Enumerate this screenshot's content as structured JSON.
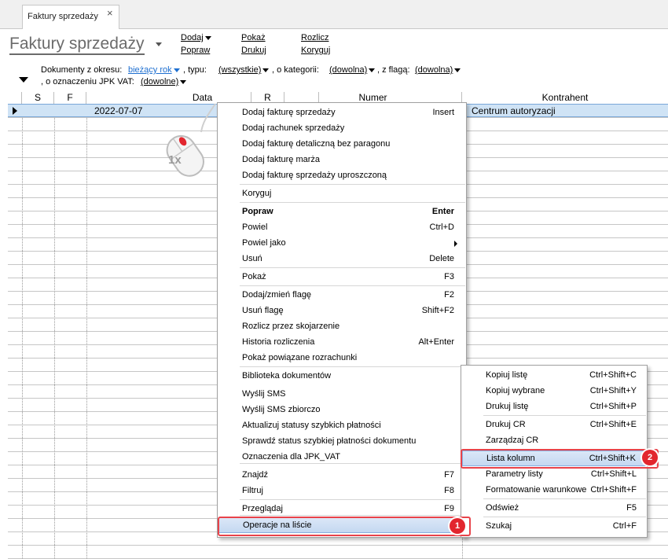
{
  "tab": {
    "label": "Faktury sprzedaży",
    "close": "×"
  },
  "page": {
    "title": "Faktury sprzedaży"
  },
  "actions": {
    "dodaj": "Dodaj",
    "popraw": "Popraw",
    "pokaz": "Pokaż",
    "drukuj": "Drukuj",
    "rozlicz": "Rozlicz",
    "koryguj": "Koryguj"
  },
  "filters": {
    "okres_label": "Dokumenty z okresu:",
    "okres_value": "bieżący rok",
    "typ_label": ", typu:",
    "typ_value": "(wszystkie)",
    "kategoria_label": ", o kategorii:",
    "kategoria_value": "(dowolna)",
    "flaga_label": ", z flagą:",
    "flaga_value": "(dowolna)",
    "jpk_label": ", o oznaczeniu JPK VAT:",
    "jpk_value": "(dowolne)"
  },
  "columns": [
    "S",
    "F",
    "Data",
    "R",
    "Numer",
    "Kontrahent"
  ],
  "selected_row": {
    "data": "2022-07-07",
    "kontrahent": "Centrum autoryzacji"
  },
  "mouse_hint": "1x",
  "context_menu": {
    "items": [
      {
        "label": "Dodaj fakturę sprzedaży",
        "shortcut": "Insert"
      },
      {
        "label": "Dodaj rachunek sprzedaży",
        "shortcut": ""
      },
      {
        "label": "Dodaj fakturę detaliczną bez paragonu",
        "shortcut": ""
      },
      {
        "label": "Dodaj fakturę marża",
        "shortcut": ""
      },
      {
        "label": "Dodaj fakturę sprzedaży uproszczoną",
        "shortcut": ""
      },
      {
        "label": "Koryguj",
        "shortcut": ""
      },
      {
        "label": "Popraw",
        "shortcut": "Enter"
      },
      {
        "label": "Powiel",
        "shortcut": "Ctrl+D"
      },
      {
        "label": "Powiel jako",
        "shortcut": ""
      },
      {
        "label": "Usuń",
        "shortcut": "Delete"
      },
      {
        "label": "Pokaż",
        "shortcut": "F3"
      },
      {
        "label": "Dodaj/zmień flagę",
        "shortcut": "F2"
      },
      {
        "label": "Usuń flagę",
        "shortcut": "Shift+F2"
      },
      {
        "label": "Rozlicz przez skojarzenie",
        "shortcut": ""
      },
      {
        "label": "Historia rozliczenia",
        "shortcut": "Alt+Enter"
      },
      {
        "label": "Pokaż powiązane rozrachunki",
        "shortcut": ""
      },
      {
        "label": "Biblioteka dokumentów",
        "shortcut": ""
      },
      {
        "label": "Wyślij SMS",
        "shortcut": ""
      },
      {
        "label": "Wyślij SMS zbiorczo",
        "shortcut": ""
      },
      {
        "label": "Aktualizuj statusy szybkich płatności",
        "shortcut": ""
      },
      {
        "label": "Sprawdź status szybkiej płatności dokumentu",
        "shortcut": ""
      },
      {
        "label": "Oznaczenia dla JPK_VAT",
        "shortcut": ""
      },
      {
        "label": "Znajdź",
        "shortcut": "F7"
      },
      {
        "label": "Filtruj",
        "shortcut": "F8"
      },
      {
        "label": "Przeglądaj",
        "shortcut": "F9"
      },
      {
        "label": "Operacje na liście",
        "shortcut": ""
      }
    ]
  },
  "submenu": {
    "items": [
      {
        "label": "Kopiuj listę",
        "shortcut": "Ctrl+Shift+C"
      },
      {
        "label": "Kopiuj wybrane",
        "shortcut": "Ctrl+Shift+Y"
      },
      {
        "label": "Drukuj listę",
        "shortcut": "Ctrl+Shift+P"
      },
      {
        "label": "Drukuj CR",
        "shortcut": "Ctrl+Shift+E"
      },
      {
        "label": "Zarządzaj CR",
        "shortcut": ""
      },
      {
        "label": "Lista kolumn",
        "shortcut": "Ctrl+Shift+K"
      },
      {
        "label": "Parametry listy",
        "shortcut": "Ctrl+Shift+L"
      },
      {
        "label": "Formatowanie warunkowe",
        "shortcut": "Ctrl+Shift+F"
      },
      {
        "label": "Odśwież",
        "shortcut": "F5"
      },
      {
        "label": "Szukaj",
        "shortcut": "Ctrl+F"
      }
    ]
  },
  "badges": {
    "one": "1",
    "two": "2"
  },
  "colors": {
    "selection": "#cfe3f5",
    "highlight_border": "#e8434a",
    "badge": "#e2262e"
  }
}
